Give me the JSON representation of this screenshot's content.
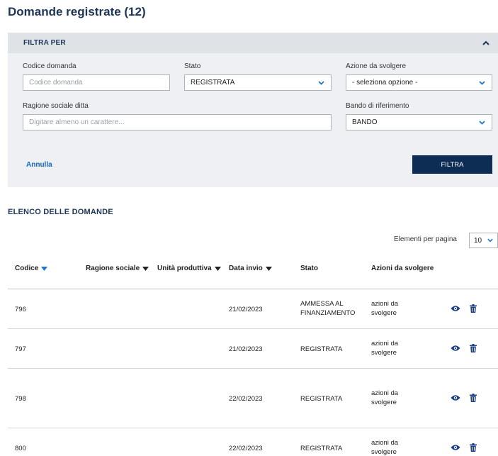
{
  "page": {
    "title": "Domande registrate (12)"
  },
  "filter": {
    "header": "FILTRA PER",
    "codice": {
      "label": "Codice domanda",
      "placeholder": "Codice domanda",
      "value": ""
    },
    "stato": {
      "label": "Stato",
      "value": "REGISTRATA"
    },
    "azione": {
      "label": "Azione da svolgere",
      "value": "- seleziona opzione -"
    },
    "ragione": {
      "label": "Ragione sociale ditta",
      "placeholder": "Digitare almeno un carattere...",
      "value": ""
    },
    "bando": {
      "label": "Bando di riferimento",
      "value": "BANDO"
    },
    "cancel_label": "Annulla",
    "submit_label": "FILTRA"
  },
  "list": {
    "title": "ELENCO DELLE DOMANDE",
    "per_page_label": "Elementi per pagina",
    "per_page_value": "10",
    "columns": {
      "codice": "Codice",
      "ragione": "Ragione sociale",
      "unita": "Unità produttiva",
      "data": "Data invio",
      "stato": "Stato",
      "azioni": "Azioni da svolgere"
    },
    "rows": [
      {
        "codice": "796",
        "data": "21/02/2023",
        "stato": "AMMESSA AL FINANZIAMENTO",
        "azioni": "azioni da svolgere"
      },
      {
        "codice": "797",
        "data": "21/02/2023",
        "stato": "REGISTRATA",
        "azioni": "azioni da svolgere"
      },
      {
        "codice": "798",
        "data": "22/02/2023",
        "stato": "REGISTRATA",
        "azioni": "azioni da svolgere"
      },
      {
        "codice": "800",
        "data": "22/02/2023",
        "stato": "REGISTRATA",
        "azioni": "azioni da svolgere"
      }
    ]
  },
  "icons": {
    "collapse": "chevron-up-icon",
    "select": "chevron-down-icon",
    "sort_active": "triangle-down-icon",
    "view": "eye-icon",
    "delete": "trash-icon"
  },
  "colors": {
    "title": "#1d3557",
    "primary_button": "#0d2d55",
    "link": "#1565c0",
    "select_chevron": "#1976d2",
    "row_icons": "#1d3f8a"
  }
}
